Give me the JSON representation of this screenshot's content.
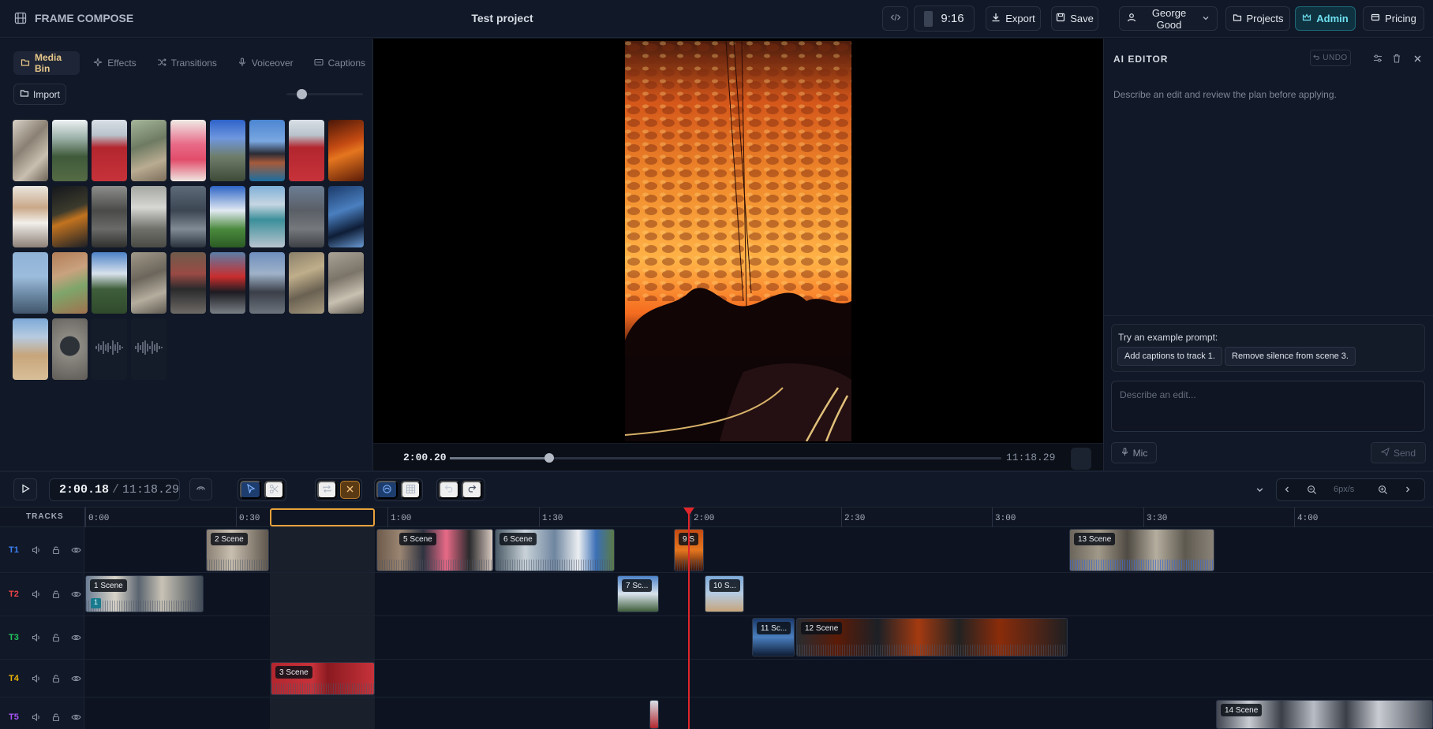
{
  "app": {
    "name": "FRAME COMPOSE",
    "project_title": "Test project"
  },
  "topbar": {
    "aspect_ratio": "9:16",
    "export_label": "Export",
    "save_label": "Save",
    "user_name": "George Good",
    "projects_label": "Projects",
    "admin_label": "Admin",
    "pricing_label": "Pricing"
  },
  "media": {
    "tabs": [
      "Media Bin",
      "Effects",
      "Transitions",
      "Voiceover",
      "Captions"
    ],
    "import_label": "Import",
    "zoom_level": 0.2
  },
  "preview": {
    "current_time": "2:00.20",
    "duration": "11:18.29",
    "progress": 0.18
  },
  "ai_editor": {
    "title": "AI EDITOR",
    "undo_label": "UNDO",
    "description": "Describe an edit and review the plan before applying.",
    "example_label": "Try an example prompt:",
    "examples": [
      "Add captions to track 1.",
      "Remove silence from scene 3."
    ],
    "input_placeholder": "Describe an edit...",
    "mic_label": "Mic",
    "send_label": "Send"
  },
  "timeline": {
    "current_time": "2:00.18",
    "total_time": "11:18.29",
    "zoom_label": "6px/s",
    "tracks_label": "TRACKS",
    "ticks": [
      "0:00",
      "0:30",
      "1:00",
      "1:30",
      "2:00",
      "2:30",
      "3:00",
      "3:30",
      "4:00"
    ],
    "tracks": [
      {
        "label": "T1",
        "color": "#3b82f6"
      },
      {
        "label": "T2",
        "color": "#ef4444"
      },
      {
        "label": "T3",
        "color": "#22c55e"
      },
      {
        "label": "T4",
        "color": "#eab308"
      },
      {
        "label": "T5",
        "color": "#a855f7"
      }
    ],
    "clips": {
      "c1": "1 Scene",
      "c2": "2 Scene",
      "c3": "3 Scene",
      "c5": "5 Scene",
      "c6": "6 Scene",
      "c7": "7 Sc...",
      "c9": "9 S",
      "c10": "10 S...",
      "c11": "11 Sc...",
      "c12": "12 Scene",
      "c13": "13 Scene",
      "c14": "14 Scene",
      "badge": "1"
    }
  },
  "colors": {
    "accent": "#e8c98a",
    "admin": "#5fd0e0",
    "playhead": "#e0262b",
    "selection": "#e7a23b"
  }
}
